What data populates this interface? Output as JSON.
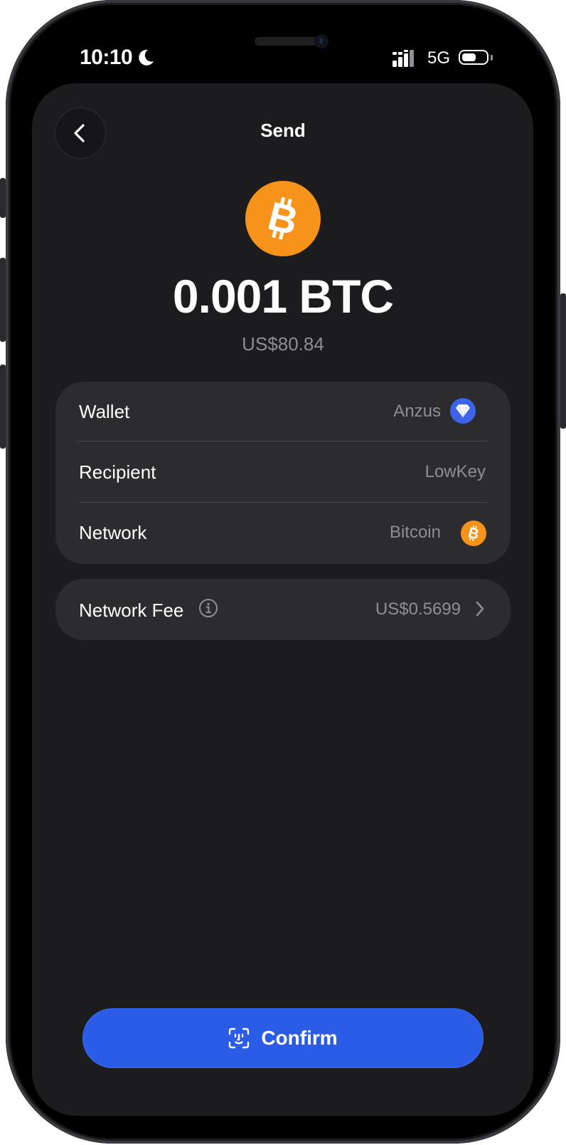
{
  "status_bar": {
    "time": "10:10",
    "network": "5G",
    "battery_level": 0.6
  },
  "header": {
    "title": "Send"
  },
  "asset": {
    "amount": "0.001 BTC",
    "fiat": "US$80.84"
  },
  "details": {
    "wallet": {
      "label": "Wallet",
      "value": "Anzus"
    },
    "recipient": {
      "label": "Recipient",
      "value": "LowKey"
    },
    "network": {
      "label": "Network",
      "value": "Bitcoin"
    }
  },
  "fee": {
    "label": "Network Fee",
    "value": "US$0.5699"
  },
  "actions": {
    "confirm_label": "Confirm"
  },
  "colors": {
    "accent": "#2b5ce6",
    "bitcoin": "#f7931a",
    "wallet_icon": "#3d63e8",
    "background": "#1c1c1e",
    "card": "#2c2c2e"
  },
  "icons": {
    "back": "chevron-left-icon",
    "coin": "bitcoin-icon",
    "wallet": "diamond-icon",
    "info": "info-icon",
    "chevron": "chevron-right-icon",
    "confirm": "face-id-icon"
  }
}
